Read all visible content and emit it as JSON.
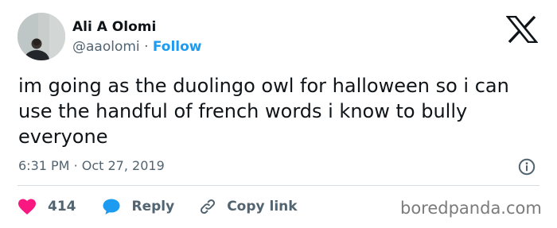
{
  "author": {
    "display_name": "Ali A Olomi",
    "handle": "@aaolomi",
    "separator": "·",
    "follow_label": "Follow"
  },
  "tweet": {
    "text": "im going as the duolingo owl for halloween so i can use the handful of french words i know to bully everyone",
    "time": "6:31 PM",
    "separator": "·",
    "date": "Oct 27, 2019"
  },
  "actions": {
    "likes_count": "414",
    "reply_label": "Reply",
    "copy_link_label": "Copy link"
  },
  "watermark": "boredpanda.com",
  "icons": {
    "logo": "x-logo-icon",
    "info": "info-icon",
    "like": "heart-icon",
    "reply": "speech-bubble-icon",
    "copy": "link-icon"
  },
  "colors": {
    "text": "#0f1419",
    "secondary": "#536471",
    "accent": "#1d9bf0",
    "like": "#f91880",
    "divider": "#d6dcdf"
  }
}
